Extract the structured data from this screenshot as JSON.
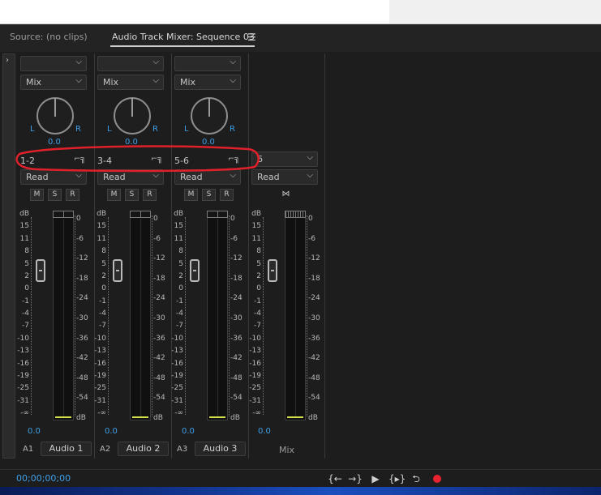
{
  "tabs": [
    {
      "label": "Source: (no clips)"
    },
    {
      "label": "Audio Track Mixer: Sequence 03"
    }
  ],
  "panel_menu_icon": "hamburger-menu-icon",
  "expander_glyph": "›",
  "channels": [
    {
      "top_dropdown": "",
      "mode_dropdown": "Mix",
      "pan_left": "L",
      "pan_right": "R",
      "pan_value": "0.0",
      "output": "1-2",
      "automation": "Read",
      "mute": "M",
      "solo": "S",
      "record": "R",
      "volume": "0.0",
      "track_id": "A1",
      "track_name": "Audio 1"
    },
    {
      "top_dropdown": "",
      "mode_dropdown": "Mix",
      "pan_left": "L",
      "pan_right": "R",
      "pan_value": "0.0",
      "output": "3-4",
      "automation": "Read",
      "mute": "M",
      "solo": "S",
      "record": "R",
      "volume": "0.0",
      "track_id": "A2",
      "track_name": "Audio 2"
    },
    {
      "top_dropdown": "",
      "mode_dropdown": "Mix",
      "pan_left": "L",
      "pan_right": "R",
      "pan_value": "0.0",
      "output": "5-6",
      "automation": "Read",
      "mute": "M",
      "solo": "S",
      "record": "R",
      "volume": "0.0",
      "track_id": "A3",
      "track_name": "Audio 3"
    }
  ],
  "master": {
    "output": "6",
    "automation": "Read",
    "volume": "0.0",
    "name": "Mix"
  },
  "fader_scale": [
    "dB",
    "15",
    "11",
    "8",
    "5",
    "2",
    "0",
    "-1",
    "-4",
    "-7",
    "-10",
    "-13",
    "-16",
    "-19",
    "-25",
    "-31",
    "-∞"
  ],
  "meter_scale": [
    "0",
    "-6",
    "-12",
    "-18",
    "-24",
    "-30",
    "-36",
    "-42",
    "-48",
    "-54",
    "dB"
  ],
  "timecode": "00;00;00;00",
  "transport": [
    "go-to-in-icon",
    "go-to-out-icon",
    "play-icon",
    "play-in-to-out-icon",
    "loop-icon",
    "record-icon"
  ],
  "colors": {
    "accent": "#3f9fe8",
    "record": "#e8222f",
    "annotation": "#e0202a",
    "meter_floor": "#d5e14a"
  }
}
